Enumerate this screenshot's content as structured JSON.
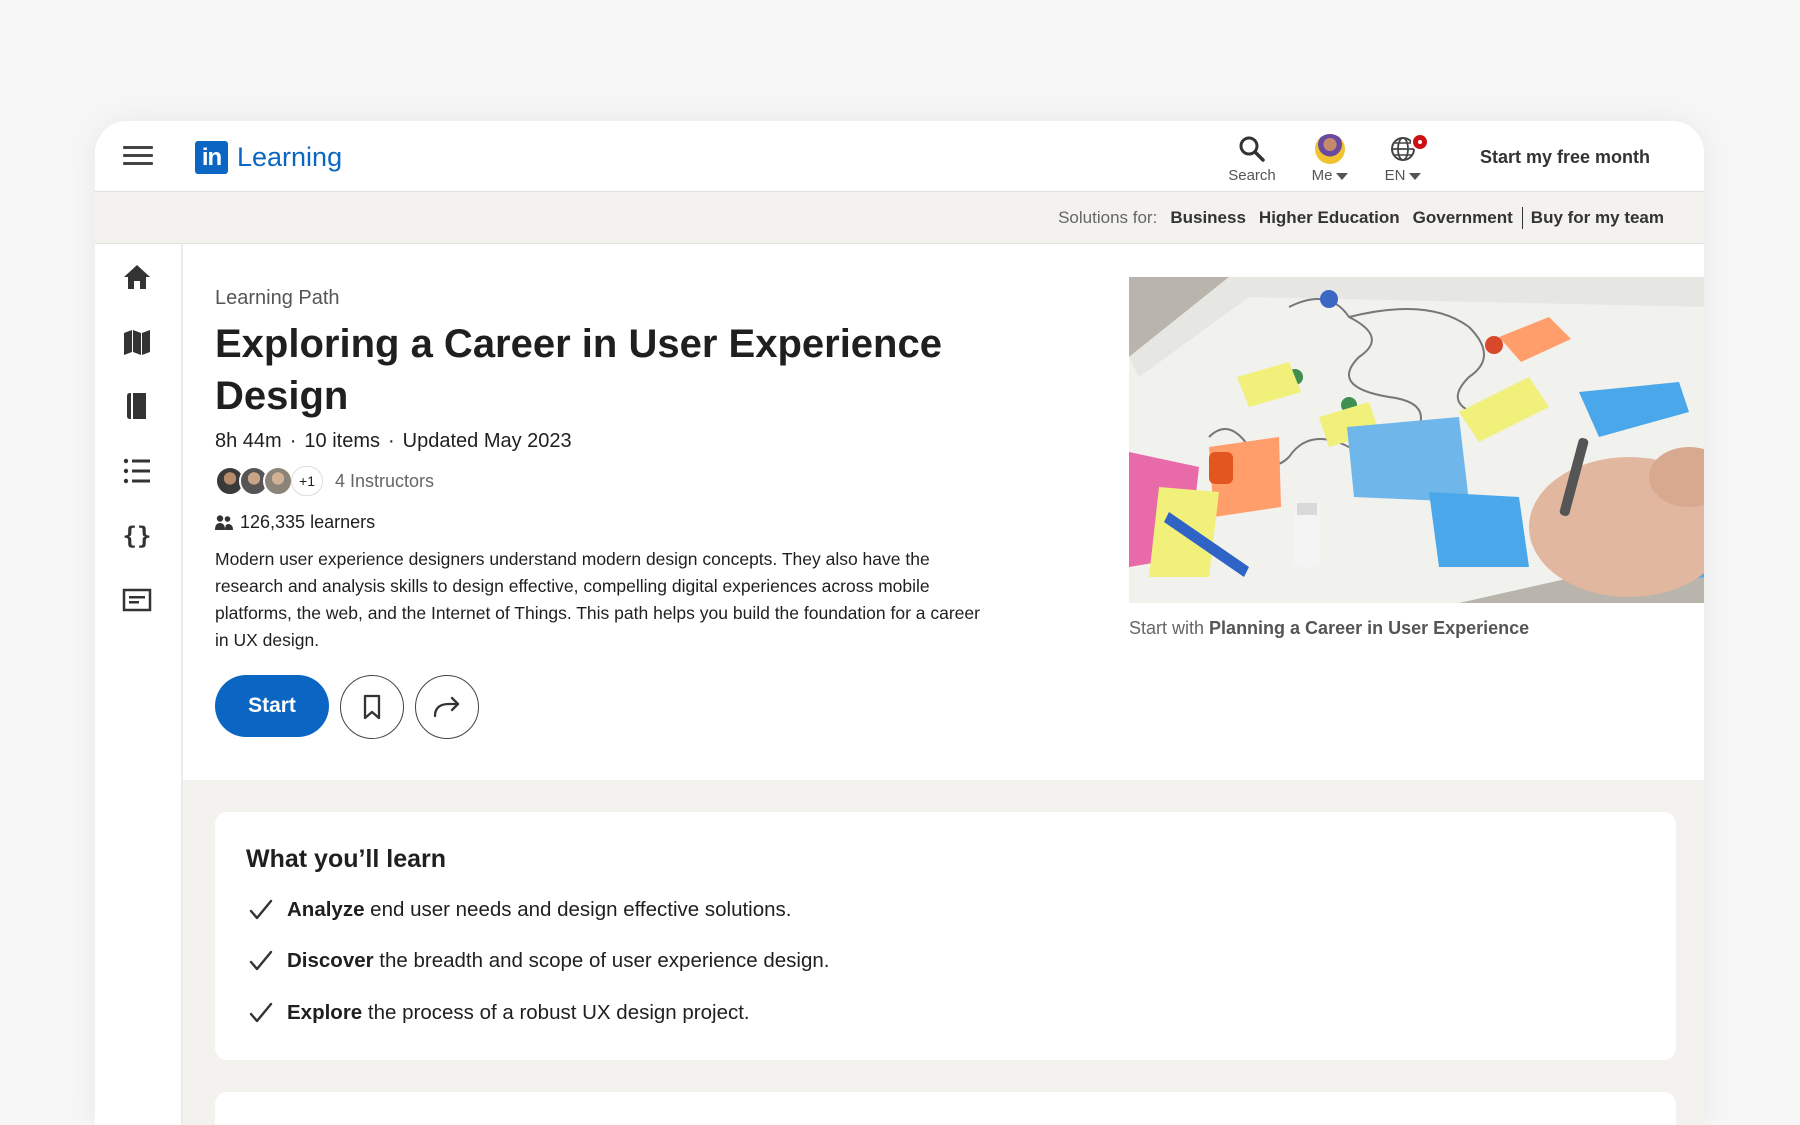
{
  "header": {
    "brand_mark": "in",
    "brand_name": "Learning",
    "search_label": "Search",
    "me_label": "Me",
    "lang_label": "EN",
    "cta_label": "Start my free month"
  },
  "solutions": {
    "label": "Solutions for:",
    "links": [
      "Business",
      "Higher Education",
      "Government",
      "Buy for my team"
    ]
  },
  "rail": [
    "home-icon",
    "map-icon",
    "book-icon",
    "list-icon",
    "code-icon",
    "certificate-icon"
  ],
  "hero": {
    "eyebrow": "Learning Path",
    "title": "Exploring a Career in User Experience Design",
    "duration": "8h 44m",
    "items": "10 items",
    "updated": "Updated May 2023",
    "instructors_extra": "+1",
    "instructors_label": "4 Instructors",
    "learners": "126,335 learners",
    "description": "Modern user experience designers understand modern design concepts. They also have the research and analysis skills to design effective, compelling digital experiences across mobile platforms, the web, and the Internet of Things. This path helps you build the foundation for a career in UX design.",
    "start_label": "Start",
    "caption_prefix": "Start with",
    "caption_course": "Planning a Career in User Experience"
  },
  "learn": {
    "heading": "What you’ll learn",
    "items": [
      {
        "bold": "Analyze",
        "rest": " end user needs and design effective solutions."
      },
      {
        "bold": "Discover",
        "rest": " the breadth and scope of user experience design."
      },
      {
        "bold": "Explore",
        "rest": " the process of a robust UX design project."
      }
    ]
  },
  "colors": {
    "brand": "#0a66c2",
    "notification": "#cc1016"
  }
}
